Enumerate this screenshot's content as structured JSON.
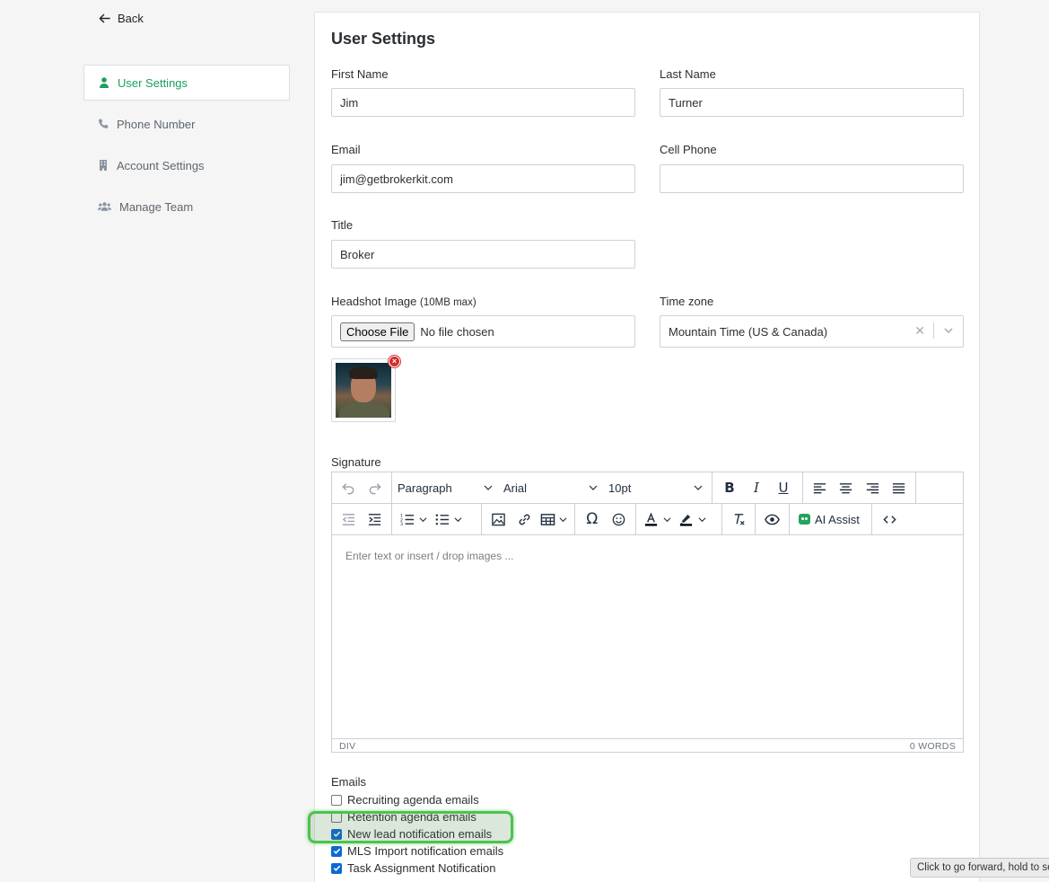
{
  "nav": {
    "back_label": "Back",
    "items": [
      {
        "label": "User Settings",
        "active": true,
        "icon": "user-icon"
      },
      {
        "label": "Phone Number",
        "active": false,
        "icon": "phone-icon"
      },
      {
        "label": "Account Settings",
        "active": false,
        "icon": "building-icon"
      },
      {
        "label": "Manage Team",
        "active": false,
        "icon": "users-icon"
      }
    ]
  },
  "form": {
    "title": "User Settings",
    "first_name": {
      "label": "First Name",
      "value": "Jim"
    },
    "last_name": {
      "label": "Last Name",
      "value": "Turner"
    },
    "email": {
      "label": "Email",
      "value": "jim@getbrokerkit.com"
    },
    "cell_phone": {
      "label": "Cell Phone",
      "value": ""
    },
    "title_field": {
      "label": "Title",
      "value": "Broker"
    },
    "headshot": {
      "label": "Headshot Image",
      "hint": "(10MB max)",
      "button": "Choose File",
      "status": "No file chosen"
    },
    "timezone": {
      "label": "Time zone",
      "value": "Mountain Time (US & Canada)"
    },
    "signature": {
      "label": "Signature",
      "block_format": "Paragraph",
      "font_family": "Arial",
      "font_size": "10pt",
      "ai_assist": "AI Assist",
      "placeholder": "Enter text or insert / drop images ...",
      "path": "DIV",
      "word_count": "0 WORDS"
    },
    "emails": {
      "label": "Emails",
      "options": [
        {
          "label": "Recruiting agenda emails",
          "checked": false
        },
        {
          "label": "Retention agenda emails",
          "checked": false
        },
        {
          "label": "New lead notification emails",
          "checked": true
        },
        {
          "label": "MLS Import notification emails",
          "checked": true
        },
        {
          "label": "Task Assignment Notification",
          "checked": true
        }
      ]
    }
  },
  "tooltip": "Click to go forward, hold to see history",
  "colors": {
    "accent": "#1a9f5f",
    "checkbox": "#0b6ad4",
    "highlight": "#4dc24d"
  }
}
